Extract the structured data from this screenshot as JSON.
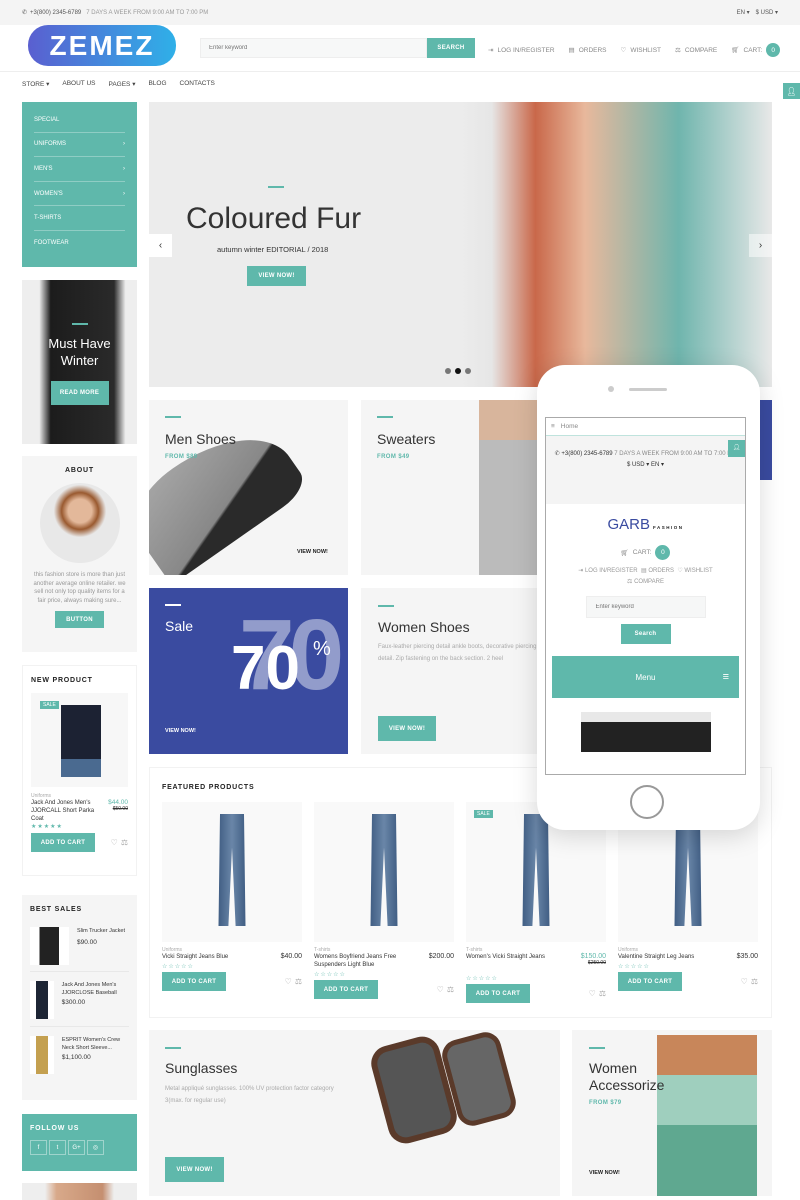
{
  "topbar": {
    "phone": "+3(800) 2345-6789",
    "hours": "7 DAYS A WEEK FROM 9:00 AM TO 7:00 PM",
    "lang": "EN",
    "currency": "$ USD"
  },
  "header": {
    "logo": "ZEMEZ",
    "search_placeholder": "Enter keyword",
    "search_button": "SEARCH",
    "login": "LOG IN/REGISTER",
    "orders": "ORDERS",
    "wishlist": "WISHLIST",
    "compare": "COMPARE",
    "cart": "CART:",
    "cart_count": "0"
  },
  "nav": [
    "STORE",
    "ABOUT US",
    "PAGES",
    "BLOG",
    "CONTACTS"
  ],
  "categories": [
    {
      "label": "SPECIAL",
      "sub": false
    },
    {
      "label": "UNIFORMS",
      "sub": true
    },
    {
      "label": "MEN'S",
      "sub": true
    },
    {
      "label": "WOMEN'S",
      "sub": true
    },
    {
      "label": "T-SHIRTS",
      "sub": false
    },
    {
      "label": "FOOTWEAR",
      "sub": false
    }
  ],
  "winter": {
    "title": "Must Have Winter",
    "button": "READ MORE"
  },
  "about": {
    "title": "ABOUT",
    "text": "this fashion store is more than just another average online retailer. we sell not only top quality items for a fair price, always making sure...",
    "button": "BUTTON"
  },
  "new_product": {
    "title": "NEW PRODUCT",
    "badge": "SALE",
    "category": "Uniforms",
    "name": "Jack And Jones Men's JJORCALL Short Parka Coat",
    "price": "$44.00",
    "old_price": "$50.00",
    "stars": "★★★★★",
    "button": "ADD TO CART"
  },
  "best_sales": {
    "title": "BEST SALES",
    "items": [
      {
        "name": "Slim Trucker Jacket",
        "price": "$90.00"
      },
      {
        "name": "Jack And Jones Men's JJORCLOSE Baseball",
        "price": "$300.00"
      },
      {
        "name": "ESPRIT Women's Crew Neck Short Sleeve...",
        "price": "$1,100.00"
      }
    ]
  },
  "follow": {
    "title": "FOLLOW US",
    "icons": [
      "f",
      "t",
      "G+",
      "◎"
    ]
  },
  "hero": {
    "title": "Coloured Fur",
    "subtitle": "autumn winter EDITORIAL / 2018",
    "button": "VIEW NOW!",
    "active_slide": 2,
    "slides": 3
  },
  "tiles": {
    "men": {
      "title": "Men Shoes",
      "from": "FROM $89",
      "cta": "VIEW NOW!"
    },
    "sweaters": {
      "title": "Sweaters",
      "from": "FROM $49"
    },
    "sale": {
      "title": "Sale",
      "big": "70",
      "pct": "%",
      "cta": "VIEW NOW!"
    },
    "women_shoes": {
      "title": "Women Shoes",
      "text": "Faux-leather piercing detail ankle boots, decorative piercing detail. Zip fastening on the back section. 2 heel",
      "cta": "VIEW NOW!"
    }
  },
  "featured": {
    "title": "FEATURED PRODUCTS",
    "button": "ADD TO CART",
    "items": [
      {
        "category": "Uniforms",
        "name": "Vicki Straight Jeans Blue",
        "price": "$40.00",
        "old_price": "",
        "sale": false
      },
      {
        "category": "T-shirts",
        "name": "Womens Boyfriend Jeans Free Suspenders Light Blue",
        "price": "$200.00",
        "old_price": "",
        "sale": false
      },
      {
        "category": "T-shirts",
        "name": "Women's Vicki Straight Jeans",
        "price": "$150.00",
        "old_price": "$250.00",
        "sale": true,
        "badge": "SALE"
      },
      {
        "category": "Uniforms",
        "name": "Valentine Straight Leg Jeans",
        "price": "$35.00",
        "old_price": "",
        "sale": false
      }
    ],
    "stars": "☆☆☆☆☆"
  },
  "sunglasses": {
    "title": "Sunglasses",
    "text": "Metal appliqué sunglasses. 100% UV protection factor category 3(max. for regular use)",
    "button": "VIEW NOW!"
  },
  "accessorize": {
    "title": "Women Accessorize",
    "from": "FROM $79",
    "cta": "VIEW NOW!"
  },
  "phone_mock": {
    "home": "Home",
    "phone": "+3(800) 2345-6789",
    "hours": "7 DAYS A WEEK FROM 9:00 AM TO 7:00 PM",
    "currency": "$ USD",
    "lang": "EN",
    "logo": "GARB",
    "logo_sub": "FASHION",
    "cart": "CART:",
    "cart_count": "0",
    "login": "LOG IN/REGISTER",
    "orders": "ORDERS",
    "wishlist": "WISHLIST",
    "compare": "COMPARE",
    "search_placeholder": "Enter keyword",
    "search_button": "Search",
    "menu": "Menu"
  },
  "colors": {
    "accent": "#5fb8ab",
    "sale_blue": "#3a4ba0"
  }
}
